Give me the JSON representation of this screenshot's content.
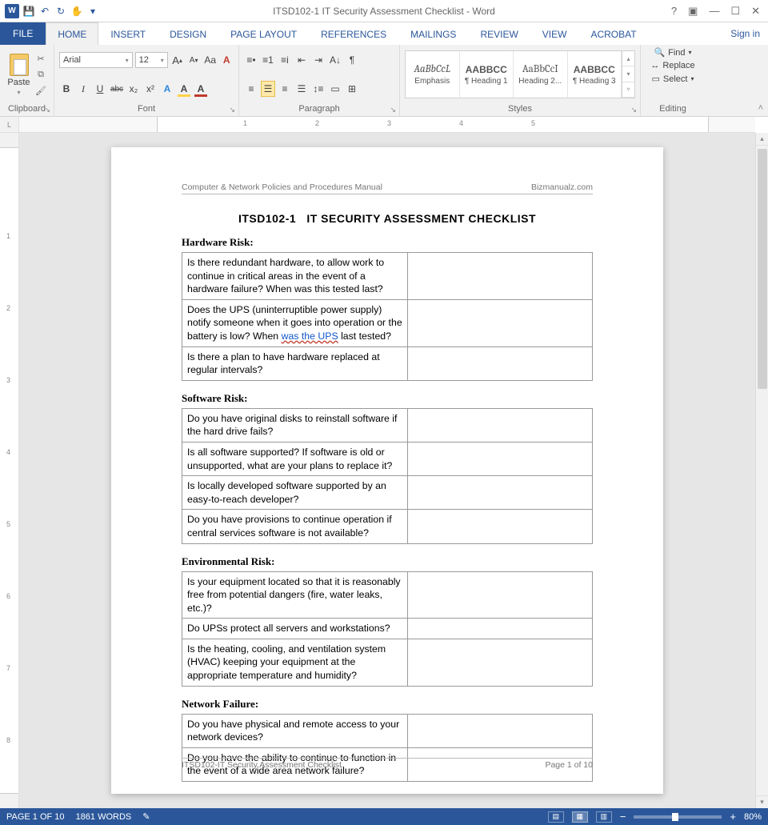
{
  "window": {
    "app_name": "Word",
    "doc_title": "ITSD102-1 IT Security Assessment Checklist - Word",
    "signin": "Sign in"
  },
  "qat": {
    "save": "💾",
    "undo": "↶",
    "redo": "↻",
    "touch": "✋"
  },
  "tabs": {
    "file": "FILE",
    "home": "HOME",
    "insert": "INSERT",
    "design": "DESIGN",
    "page_layout": "PAGE LAYOUT",
    "references": "REFERENCES",
    "mailings": "MAILINGS",
    "review": "REVIEW",
    "view": "VIEW",
    "acrobat": "ACROBAT"
  },
  "ribbon": {
    "clipboard": {
      "label": "Clipboard",
      "paste": "Paste"
    },
    "font": {
      "label": "Font",
      "name": "Arial",
      "size": "12",
      "bold": "B",
      "italic": "I",
      "underline": "U",
      "strike": "abc",
      "sub": "x₂",
      "sup": "x²",
      "grow": "A",
      "shrink": "A",
      "case": "Aa",
      "clear": "A",
      "effects": "A",
      "highlight": "A",
      "fontcolor": "A"
    },
    "paragraph": {
      "label": "Paragraph"
    },
    "styles": {
      "label": "Styles",
      "items": [
        {
          "preview": "AaBbCcL",
          "name": "Emphasis"
        },
        {
          "preview": "AABBCC",
          "name": "¶ Heading 1"
        },
        {
          "preview": "AaBbCcI",
          "name": "Heading 2..."
        },
        {
          "preview": "AABBCC",
          "name": "¶ Heading 3"
        }
      ]
    },
    "editing": {
      "label": "Editing",
      "find": "Find",
      "replace": "Replace",
      "select": "Select"
    }
  },
  "ruler": {
    "h_ticks": [
      "1",
      "2",
      "3",
      "4",
      "5"
    ],
    "v_ticks": [
      "1",
      "2",
      "3",
      "4",
      "5",
      "6",
      "7",
      "8"
    ]
  },
  "document": {
    "header_left": "Computer & Network Policies and Procedures Manual",
    "header_right": "Bizmanualz.com",
    "title_code": "ITSD102-1",
    "title_text": "IT SECURITY ASSESSMENT CHECKLIST",
    "sections": [
      {
        "name": "Hardware Risk:",
        "rows": [
          "Is there redundant hardware, to allow work to continue in critical areas in the event of a hardware failure?  When was this tested last?",
          "Does the UPS (uninterruptible power supply) notify someone when it goes into operation or the battery is low? When <LINK>was the UPS</LINK> last tested?",
          "Is there a plan to have hardware replaced at regular intervals?"
        ]
      },
      {
        "name": "Software Risk:",
        "rows": [
          "Do you have original disks to reinstall software if the hard drive fails?",
          "Is all software supported?  If software is old or unsupported, what are your plans to replace it?",
          "Is locally developed software supported by an easy-to-reach developer?",
          "Do you have provisions to continue operation if central services software is not available?"
        ]
      },
      {
        "name": "Environmental Risk:",
        "rows": [
          "Is your equipment located so that it is reasonably free from potential dangers (fire, water leaks, etc.)?",
          "Do UPSs protect all servers and workstations?",
          "Is the heating, cooling, and ventilation system (HVAC) keeping your equipment at the appropriate temperature and humidity?"
        ]
      },
      {
        "name": "Network Failure:",
        "rows": [
          "Do you have physical and remote access to your network devices?",
          "Do you have the ability to continue to function in the event of a wide area network failure?"
        ]
      }
    ],
    "footer_left": "ITSD102-IT Security Assessment Checklist",
    "footer_right": "Page 1 of 10"
  },
  "status": {
    "page": "PAGE 1 OF 10",
    "words": "1861 WORDS",
    "proof": "✎",
    "zoom": "80%",
    "minus": "−",
    "plus": "+"
  }
}
